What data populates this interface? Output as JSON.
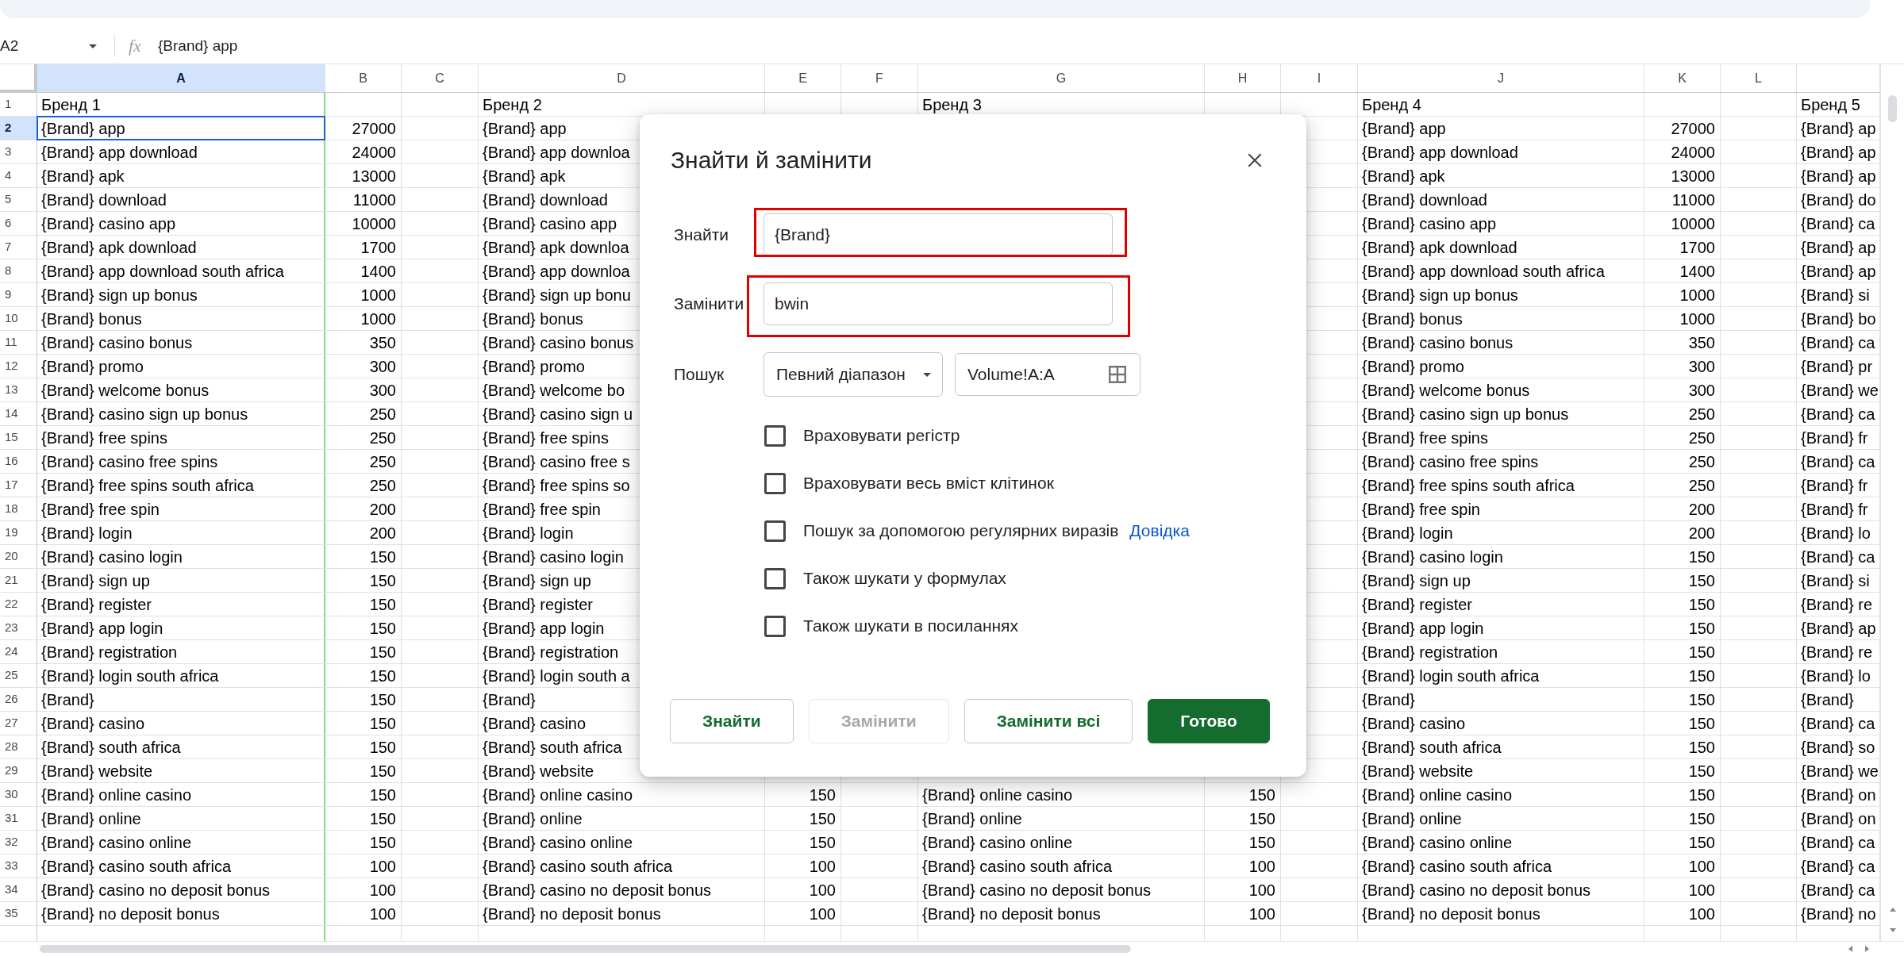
{
  "formula_bar": {
    "cell_ref": "A2",
    "function_label": "fx",
    "formula": "{Brand} app"
  },
  "columns": [
    {
      "label": "A",
      "selected": true,
      "kind": "text"
    },
    {
      "label": "B",
      "selected": false,
      "kind": "number"
    },
    {
      "label": "C",
      "selected": false
    },
    {
      "label": "D",
      "selected": false,
      "kind": "text"
    },
    {
      "label": "E",
      "selected": false,
      "kind": "number"
    },
    {
      "label": "F",
      "selected": false
    },
    {
      "label": "G",
      "selected": false,
      "kind": "text"
    },
    {
      "label": "H",
      "selected": false,
      "kind": "number"
    },
    {
      "label": "I",
      "selected": false
    },
    {
      "label": "J",
      "selected": false,
      "kind": "text"
    },
    {
      "label": "K",
      "selected": false,
      "kind": "number"
    },
    {
      "label": "L",
      "selected": false
    }
  ],
  "rows": [
    {
      "number": "1",
      "selected": false,
      "cells": [
        "Бренд 1",
        null,
        null,
        "Бренд 2",
        null,
        null,
        "Бренд 3",
        null,
        null,
        "Бренд 4",
        null,
        null,
        "Бренд 5"
      ]
    },
    {
      "number": "2",
      "selected": true,
      "cells": [
        "{Brand} app",
        "27000",
        null,
        "{Brand} app",
        null,
        null,
        null,
        null,
        null,
        "{Brand} app",
        "27000",
        null,
        "{Brand} ap"
      ]
    },
    {
      "number": "3",
      "selected": false,
      "cells": [
        "{Brand} app download",
        "24000",
        null,
        "{Brand} app downloa",
        null,
        null,
        null,
        null,
        null,
        "{Brand} app download",
        "24000",
        null,
        "{Brand} ap"
      ]
    },
    {
      "number": "4",
      "selected": false,
      "cells": [
        "{Brand} apk",
        "13000",
        null,
        "{Brand} apk",
        null,
        null,
        null,
        null,
        null,
        "{Brand} apk",
        "13000",
        null,
        "{Brand} ap"
      ]
    },
    {
      "number": "5",
      "selected": false,
      "cells": [
        "{Brand} download",
        "11000",
        null,
        "{Brand} download",
        null,
        null,
        null,
        null,
        null,
        "{Brand} download",
        "11000",
        null,
        "{Brand} do"
      ]
    },
    {
      "number": "6",
      "selected": false,
      "cells": [
        "{Brand} casino app",
        "10000",
        null,
        "{Brand} casino app",
        null,
        null,
        null,
        null,
        null,
        "{Brand} casino app",
        "10000",
        null,
        "{Brand} ca"
      ]
    },
    {
      "number": "7",
      "selected": false,
      "cells": [
        "{Brand} apk download",
        "1700",
        null,
        "{Brand} apk downloa",
        null,
        null,
        null,
        null,
        null,
        "{Brand} apk download",
        "1700",
        null,
        "{Brand} ap"
      ]
    },
    {
      "number": "8",
      "selected": false,
      "cells": [
        "{Brand} app download south africa",
        "1400",
        null,
        "{Brand} app downloa",
        null,
        null,
        null,
        null,
        null,
        "{Brand} app download south africa",
        "1400",
        null,
        "{Brand} ap"
      ]
    },
    {
      "number": "9",
      "selected": false,
      "cells": [
        "{Brand} sign up bonus",
        "1000",
        null,
        "{Brand} sign up bonu",
        null,
        null,
        null,
        null,
        null,
        "{Brand} sign up bonus",
        "1000",
        null,
        "{Brand} si"
      ]
    },
    {
      "number": "10",
      "selected": false,
      "cells": [
        "{Brand} bonus",
        "1000",
        null,
        "{Brand} bonus",
        null,
        null,
        null,
        null,
        null,
        "{Brand} bonus",
        "1000",
        null,
        "{Brand} bo"
      ]
    },
    {
      "number": "11",
      "selected": false,
      "cells": [
        "{Brand} casino bonus",
        "350",
        null,
        "{Brand} casino bonus",
        null,
        null,
        null,
        null,
        null,
        "{Brand} casino bonus",
        "350",
        null,
        "{Brand} ca"
      ]
    },
    {
      "number": "12",
      "selected": false,
      "cells": [
        "{Brand} promo",
        "300",
        null,
        "{Brand} promo",
        null,
        null,
        null,
        null,
        null,
        "{Brand} promo",
        "300",
        null,
        "{Brand} pr"
      ]
    },
    {
      "number": "13",
      "selected": false,
      "cells": [
        "{Brand} welcome bonus",
        "300",
        null,
        "{Brand} welcome bo",
        null,
        null,
        null,
        null,
        null,
        "{Brand} welcome bonus",
        "300",
        null,
        "{Brand} we"
      ]
    },
    {
      "number": "14",
      "selected": false,
      "cells": [
        "{Brand} casino sign up bonus",
        "250",
        null,
        "{Brand} casino sign u",
        null,
        null,
        null,
        null,
        null,
        "{Brand} casino sign up bonus",
        "250",
        null,
        "{Brand} ca"
      ]
    },
    {
      "number": "15",
      "selected": false,
      "cells": [
        "{Brand} free spins",
        "250",
        null,
        "{Brand} free spins",
        null,
        null,
        null,
        null,
        null,
        "{Brand} free spins",
        "250",
        null,
        "{Brand} fr"
      ]
    },
    {
      "number": "16",
      "selected": false,
      "cells": [
        "{Brand} casino free spins",
        "250",
        null,
        "{Brand} casino free s",
        null,
        null,
        null,
        null,
        null,
        "{Brand} casino free spins",
        "250",
        null,
        "{Brand} ca"
      ]
    },
    {
      "number": "17",
      "selected": false,
      "cells": [
        "{Brand} free spins south africa",
        "250",
        null,
        "{Brand} free spins so",
        null,
        null,
        null,
        null,
        null,
        "{Brand} free spins south africa",
        "250",
        null,
        "{Brand} fr"
      ]
    },
    {
      "number": "18",
      "selected": false,
      "cells": [
        "{Brand} free spin",
        "200",
        null,
        "{Brand} free spin",
        null,
        null,
        null,
        null,
        null,
        "{Brand} free spin",
        "200",
        null,
        "{Brand} fr"
      ]
    },
    {
      "number": "19",
      "selected": false,
      "cells": [
        "{Brand} login",
        "200",
        null,
        "{Brand} login",
        null,
        null,
        null,
        null,
        null,
        "{Brand} login",
        "200",
        null,
        "{Brand} lo"
      ]
    },
    {
      "number": "20",
      "selected": false,
      "cells": [
        "{Brand} casino login",
        "150",
        null,
        "{Brand} casino login",
        null,
        null,
        null,
        null,
        null,
        "{Brand} casino login",
        "150",
        null,
        "{Brand} ca"
      ]
    },
    {
      "number": "21",
      "selected": false,
      "cells": [
        "{Brand} sign up",
        "150",
        null,
        "{Brand} sign up",
        null,
        null,
        null,
        null,
        null,
        "{Brand} sign up",
        "150",
        null,
        "{Brand} si"
      ]
    },
    {
      "number": "22",
      "selected": false,
      "cells": [
        "{Brand} register",
        "150",
        null,
        "{Brand} register",
        null,
        null,
        null,
        null,
        null,
        "{Brand} register",
        "150",
        null,
        "{Brand} re"
      ]
    },
    {
      "number": "23",
      "selected": false,
      "cells": [
        "{Brand} app login",
        "150",
        null,
        "{Brand} app login",
        null,
        null,
        null,
        null,
        null,
        "{Brand} app login",
        "150",
        null,
        "{Brand} ap"
      ]
    },
    {
      "number": "24",
      "selected": false,
      "cells": [
        "{Brand} registration",
        "150",
        null,
        "{Brand} registration",
        null,
        null,
        null,
        null,
        null,
        "{Brand} registration",
        "150",
        null,
        "{Brand} re"
      ]
    },
    {
      "number": "25",
      "selected": false,
      "cells": [
        "{Brand} login south africa",
        "150",
        null,
        "{Brand} login south a",
        null,
        null,
        null,
        null,
        null,
        "{Brand} login south africa",
        "150",
        null,
        "{Brand} lo"
      ]
    },
    {
      "number": "26",
      "selected": false,
      "cells": [
        "{Brand}",
        "150",
        null,
        "{Brand}",
        null,
        null,
        null,
        null,
        null,
        "{Brand}",
        "150",
        null,
        "{Brand}"
      ]
    },
    {
      "number": "27",
      "selected": false,
      "cells": [
        "{Brand} casino",
        "150",
        null,
        "{Brand} casino",
        null,
        null,
        null,
        null,
        null,
        "{Brand} casino",
        "150",
        null,
        "{Brand} ca"
      ]
    },
    {
      "number": "28",
      "selected": false,
      "cells": [
        "{Brand} south africa",
        "150",
        null,
        "{Brand} south africa",
        null,
        null,
        null,
        null,
        null,
        "{Brand} south africa",
        "150",
        null,
        "{Brand} so"
      ]
    },
    {
      "number": "29",
      "selected": false,
      "cells": [
        "{Brand} website",
        "150",
        null,
        "{Brand} website",
        null,
        null,
        null,
        null,
        null,
        "{Brand} website",
        "150",
        null,
        "{Brand} we"
      ]
    },
    {
      "number": "30",
      "selected": false,
      "cells": [
        "{Brand} online casino",
        "150",
        null,
        "{Brand} online casino",
        "150",
        null,
        "{Brand} online casino",
        "150",
        null,
        "{Brand} online casino",
        "150",
        null,
        "{Brand} on"
      ]
    },
    {
      "number": "31",
      "selected": false,
      "cells": [
        "{Brand} online",
        "150",
        null,
        "{Brand} online",
        "150",
        null,
        "{Brand} online",
        "150",
        null,
        "{Brand} online",
        "150",
        null,
        "{Brand} on"
      ]
    },
    {
      "number": "32",
      "selected": false,
      "cells": [
        "{Brand} casino online",
        "150",
        null,
        "{Brand} casino online",
        "150",
        null,
        "{Brand} casino online",
        "150",
        null,
        "{Brand} casino online",
        "150",
        null,
        "{Brand} ca"
      ]
    },
    {
      "number": "33",
      "selected": false,
      "cells": [
        "{Brand} casino south africa",
        "100",
        null,
        "{Brand} casino south africa",
        "100",
        null,
        "{Brand} casino south africa",
        "100",
        null,
        "{Brand} casino south africa",
        "100",
        null,
        "{Brand} ca"
      ]
    },
    {
      "number": "34",
      "selected": false,
      "cells": [
        "{Brand} casino no deposit bonus",
        "100",
        null,
        "{Brand} casino no deposit bonus",
        "100",
        null,
        "{Brand} casino no deposit bonus",
        "100",
        null,
        "{Brand} casino no deposit bonus",
        "100",
        null,
        "{Brand} ca"
      ]
    },
    {
      "number": "35",
      "selected": false,
      "cells": [
        "{Brand} no deposit bonus",
        "100",
        null,
        "{Brand} no deposit bonus",
        "100",
        null,
        "{Brand} no deposit bonus",
        "100",
        null,
        "{Brand} no deposit bonus",
        "100",
        null,
        "{Brand} no"
      ]
    }
  ],
  "dialog": {
    "title": "Знайти й замінити",
    "find": {
      "label": "Знайти",
      "value": "{Brand}",
      "highlighted": true
    },
    "replace": {
      "label": "Замінити",
      "value": "bwin",
      "highlighted": true
    },
    "search": {
      "label": "Пошук",
      "scope": "Певний діапазон",
      "range": "Volume!A:A"
    },
    "options": [
      {
        "label": "Враховувати регістр",
        "checked": false
      },
      {
        "label": "Враховувати весь вміст клітинок",
        "checked": false
      },
      {
        "label": "Пошук за допомогою регулярних виразів",
        "checked": false,
        "link": "Довідка"
      },
      {
        "label": "Також шукати у формулах",
        "checked": false
      },
      {
        "label": "Також шукати в посиланнях",
        "checked": false
      }
    ],
    "buttons": [
      {
        "label": "Знайти",
        "kind": "secondary",
        "disabled": false
      },
      {
        "label": "Замінити",
        "kind": "secondary",
        "disabled": true
      },
      {
        "label": "Замінити всі",
        "kind": "secondary",
        "disabled": false
      },
      {
        "label": "Готово",
        "kind": "primary",
        "disabled": false
      }
    ]
  }
}
